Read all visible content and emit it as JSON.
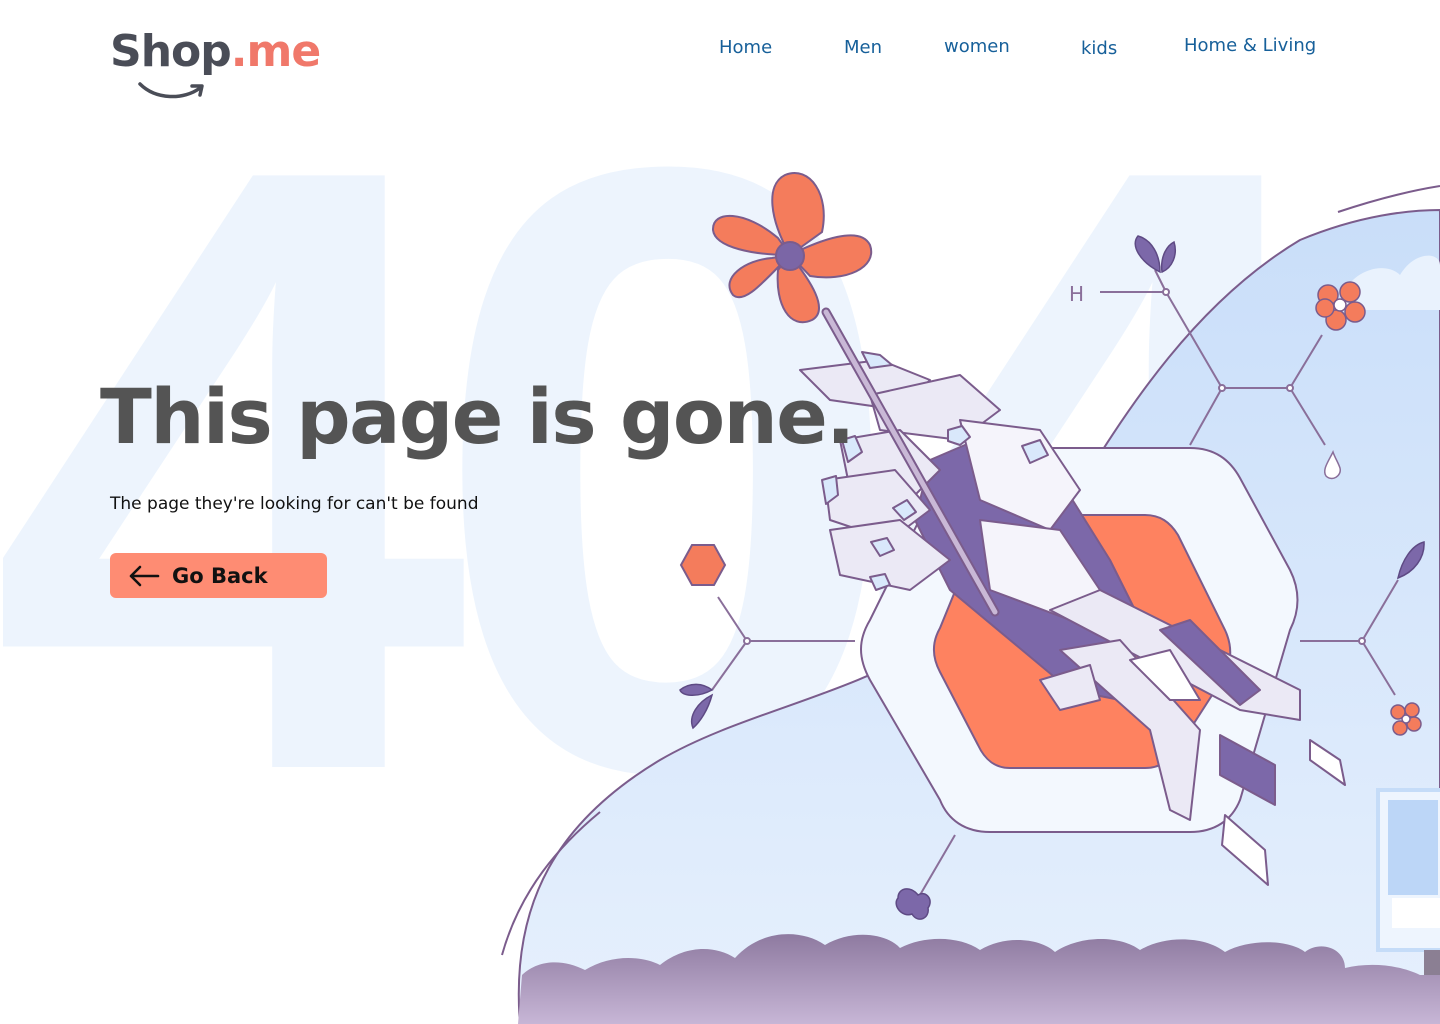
{
  "background": {
    "watermark": "404"
  },
  "brand": {
    "name_part1": "Shop",
    "name_part2": ".me"
  },
  "nav": {
    "items": [
      {
        "label": "Home"
      },
      {
        "label": "Men"
      },
      {
        "label": "women"
      },
      {
        "label": "kids"
      },
      {
        "label": "Home & Living"
      }
    ]
  },
  "main": {
    "title": "This page is gone.",
    "subtitle": "The page they're looking for can't be found",
    "back_button": {
      "label": "Go Back",
      "icon": "arrow-left-icon"
    }
  },
  "illustration": {
    "molecule_label": "H"
  },
  "colors": {
    "accent": "#fe8c73",
    "brand_dot": "#f0786a",
    "nav_text": "#17609a",
    "heading": "#545454",
    "outline": "#7b5c8c",
    "sky": "#cfe3fb",
    "purple": "#7b66a6"
  }
}
